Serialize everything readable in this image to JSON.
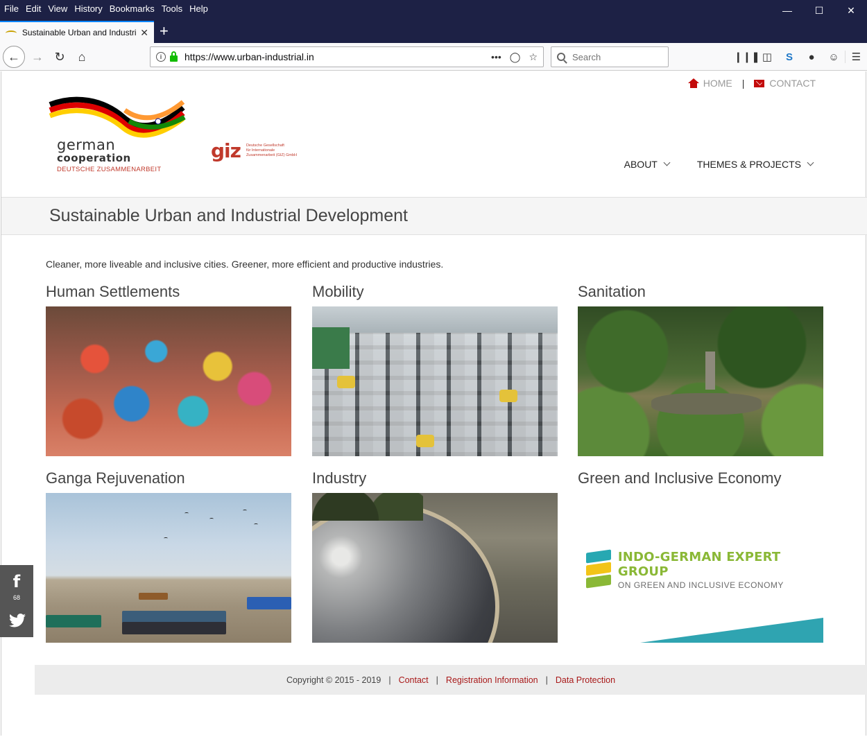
{
  "browser": {
    "menu": [
      "File",
      "Edit",
      "View",
      "History",
      "Bookmarks",
      "Tools",
      "Help"
    ],
    "tab_title": "Sustainable Urban and Industrial Development",
    "url": "https://www.urban-industrial.in",
    "search_placeholder": "Search"
  },
  "site": {
    "topnav": {
      "home": "HOME",
      "separator": "|",
      "contact": "CONTACT"
    },
    "logo": {
      "line1": "german",
      "line2": "cooperation",
      "line3": "DEUTSCHE ZUSAMMENARBEIT",
      "giz": "giz",
      "giz_small": [
        "Deutsche Gesellschaft",
        "für Internationale",
        "Zusammenarbeit (GIZ) GmbH"
      ]
    },
    "mainnav": {
      "about": "ABOUT",
      "themes": "THEMES & PROJECTS"
    },
    "page_title": "Sustainable Urban and Industrial Development",
    "intro": "Cleaner, more liveable and inclusive cities. Greener, more efficient and productive industries.",
    "cards": [
      {
        "title": "Human Settlements"
      },
      {
        "title": "Mobility"
      },
      {
        "title": "Sanitation"
      },
      {
        "title": "Ganga Rejuvenation"
      },
      {
        "title": "Industry"
      },
      {
        "title": "Green and Inclusive Economy"
      }
    ],
    "igeg": {
      "line1": "INDO-GERMAN EXPERT GROUP",
      "line2": "ON GREEN AND INCLUSIVE ECONOMY"
    },
    "footer": {
      "copyright": "Copyright © 2015 - 2019",
      "sep": "|",
      "contact": "Contact",
      "registration": "Registration Information",
      "data_protection": "Data Protection"
    },
    "social": {
      "facebook_count": "68"
    }
  },
  "colors": {
    "accent_red": "#a81818",
    "titlebar": "#1d2145",
    "igeg_green": "#8ab836",
    "igeg_teal": "#2fa4b1"
  }
}
